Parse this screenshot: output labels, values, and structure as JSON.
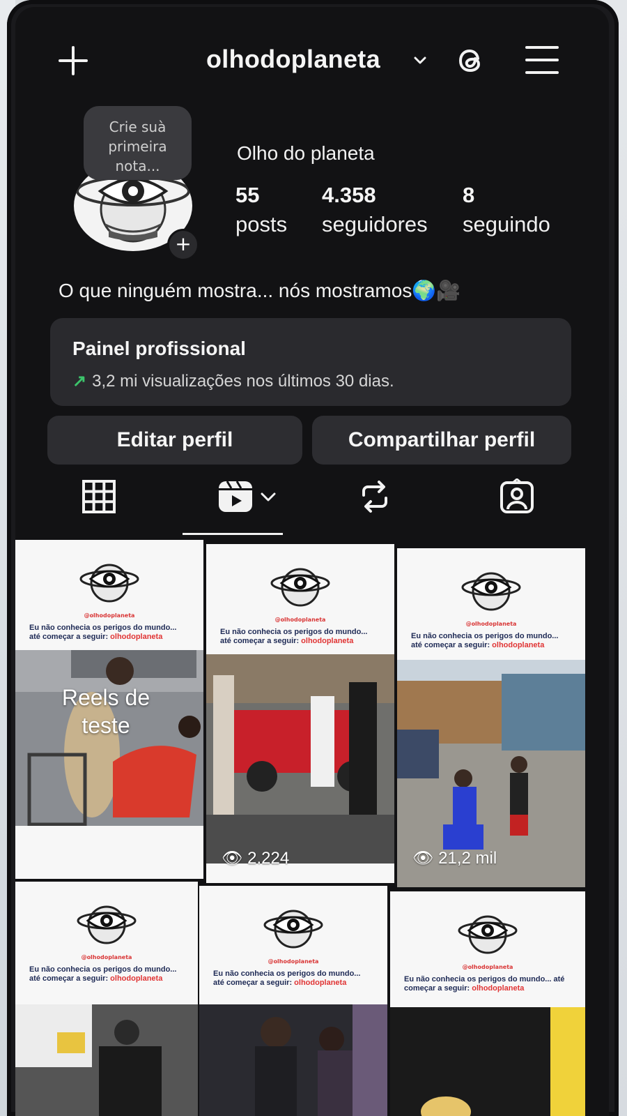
{
  "header": {
    "username": "olhodoplaneta",
    "icons": [
      "plus-icon",
      "chevron-down-icon",
      "threads-icon",
      "menu-icon"
    ]
  },
  "profile": {
    "note_prompt": "Crie suà primeira nota...",
    "display_name": "Olho do planeta",
    "stats": [
      {
        "value": "55",
        "label": "posts"
      },
      {
        "value": "4.358",
        "label": "seguidores"
      },
      {
        "value": "8",
        "label": "seguindo"
      }
    ],
    "bio": "O que ninguém mostra... nós mostramos🌍🎥"
  },
  "dashboard": {
    "title": "Painel profissional",
    "subtitle": "3,2 mi visualizações nos últimos 30 dias."
  },
  "actions": {
    "edit": "Editar perfil",
    "share": "Compartilhar perfil"
  },
  "tabs": [
    "grid-icon",
    "reels-icon",
    "reposts-icon",
    "tagged-icon"
  ],
  "reels": [
    {
      "handle": "@olhodoplaneta",
      "caption_a": "Eu não conhecia os perigos do mundo... até começar a seguir: ",
      "caption_b": "olhodoplaneta",
      "overlay": "Reels de teste",
      "views": ""
    },
    {
      "handle": "@olhodoplaneta",
      "caption_a": "Eu não conhecia os perigos do mundo... até começar a seguir: ",
      "caption_b": "olhodoplaneta",
      "overlay": "",
      "views": "2.224"
    },
    {
      "handle": "@olhodoplaneta",
      "caption_a": "Eu não conhecia os perigos do mundo... até começar a seguir: ",
      "caption_b": "olhodoplaneta",
      "overlay": "",
      "views": "21,2 mil"
    },
    {
      "handle": "@olhodoplaneta",
      "caption_a": "Eu não conhecia os perigos do mundo... até começar a seguir: ",
      "caption_b": "olhodoplaneta",
      "overlay": "",
      "views": ""
    },
    {
      "handle": "@olhodoplaneta",
      "caption_a": "Eu não conhecia os perigos do mundo... até começar a seguir: ",
      "caption_b": "olhodoplaneta",
      "overlay": "",
      "views": ""
    },
    {
      "handle": "@olhodoplaneta",
      "caption_a": "Eu não conhecia os perigos do mundo... até começar a seguir: ",
      "caption_b": "olhodoplaneta",
      "overlay": "",
      "views": ""
    }
  ],
  "colors": {
    "background": "#121214",
    "surface": "#2a2a2e",
    "accent_green": "#3cc46b",
    "handle_red": "#e03434"
  }
}
